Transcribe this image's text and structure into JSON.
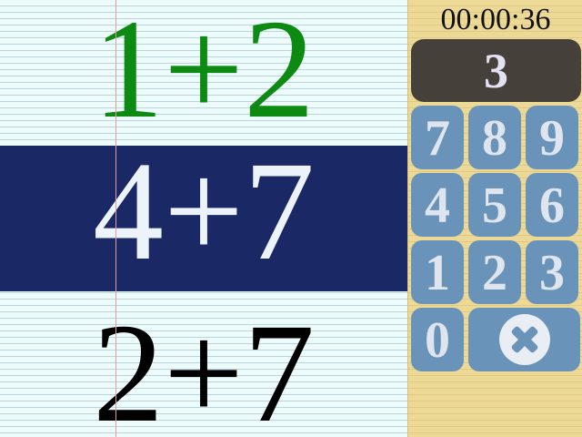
{
  "problems": {
    "previous": "1+2",
    "current": "4+7",
    "next": "2+7"
  },
  "colors": {
    "previous_text": "#0d8a12",
    "current_background": "#1a2966",
    "current_text": "#ecf3fb",
    "next_text": "#000000",
    "keypad_key": "#6a93b9",
    "answer_display": "#46403a",
    "panel_background": "#ecd996"
  },
  "timer": {
    "value": "00:00:36"
  },
  "answer": {
    "value": "3"
  },
  "keypad": {
    "keys": [
      "7",
      "8",
      "9",
      "4",
      "5",
      "6",
      "1",
      "2",
      "3",
      "0"
    ],
    "clear_icon": "clear-icon"
  }
}
